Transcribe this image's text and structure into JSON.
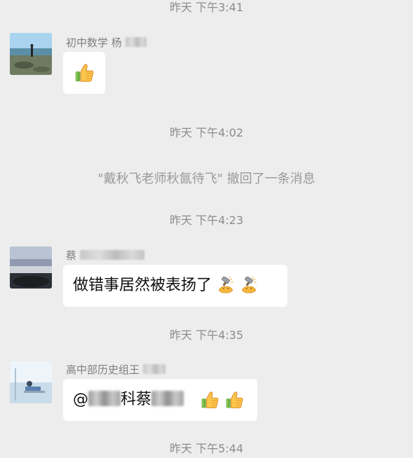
{
  "conversation": {
    "timestamps": [
      "昨天 下午3:41",
      "昨天 下午4:02",
      "昨天 下午4:23",
      "昨天 下午4:35",
      "昨天 下午5:44"
    ],
    "recall_notice": "\"戴秋飞老师秋氤待飞\" 撤回了一条消息",
    "messages": [
      {
        "sender": "初中数学 杨",
        "content": "",
        "emoji": [
          "thumbs-up-icon"
        ]
      },
      {
        "sender": "蔡",
        "content": "做错事居然被表扬了",
        "emoji": [
          "hammer-clap-icon",
          "hammer-clap-icon"
        ]
      },
      {
        "sender": "高中部历史组王",
        "content_prefix": "@",
        "content_mid": "科蔡",
        "emoji": [
          "thumbs-up-icon",
          "thumbs-up-icon"
        ]
      }
    ]
  },
  "colors": {
    "background": "#ededed",
    "bubble": "#ffffff",
    "timestamp_text": "#8c8c8c",
    "sender_text": "#7f7f7f"
  }
}
